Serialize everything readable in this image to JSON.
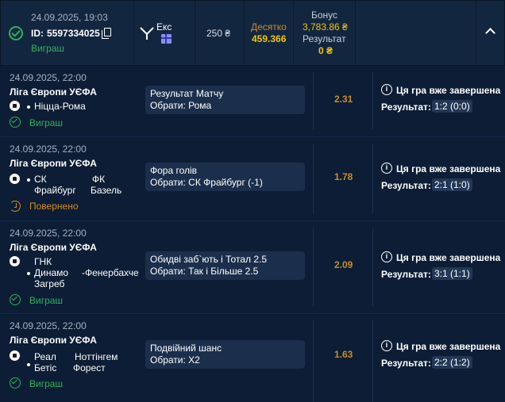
{
  "bet": {
    "date": "24.09.2025, 19:03",
    "id_label": "ID:",
    "id": "5597334025",
    "status": "Виграш",
    "type": "Екс",
    "stake": "250 ₴",
    "decimal_label": "Десятко",
    "decimal_value": "459.366",
    "bonus_label": "Бонус",
    "bonus_value": "3,783.86 ₴",
    "result_label": "Результат",
    "result_value": "0 ₴"
  },
  "events": [
    {
      "date": "24.09.2025, 22:00",
      "league": "Ліга Європи УЄФА",
      "team1": "Ніцца-Рома",
      "team2": "",
      "market": "Результат Матчу",
      "pick": "Обрати: Рома",
      "odds": "2.31",
      "status": "Виграш",
      "ended": "Ця гра вже завершена",
      "result_label": "Результат:",
      "result": "1:2 (0:0)"
    },
    {
      "date": "24.09.2025, 22:00",
      "league": "Ліга Європи УЄФА",
      "team1_l1": "СК",
      "team1_l2": "Фрайбург",
      "team2_l1": "ФК",
      "team2_l2": "Базель",
      "market": "Фора голів",
      "pick": "Обрати: СК Фрайбург (-1)",
      "odds": "1.78",
      "status": "Повернено",
      "ended": "Ця гра вже завершена",
      "result_label": "Результат:",
      "result": "2:1 (1:0)"
    },
    {
      "date": "24.09.2025, 22:00",
      "league": "Ліга Європи УЄФА",
      "team1_l1": "ГНК",
      "team1_l2": "Динамо",
      "team1_l3": "Загреб",
      "team2_l1": "-Фенербахче",
      "market": "Обидві заб`ють і Тотал 2.5",
      "pick": "Обрати: Так і Більше 2.5",
      "odds": "2.09",
      "status": "Виграш",
      "ended": "Ця гра вже завершена",
      "result_label": "Результат:",
      "result": "3:1 (1:1)"
    },
    {
      "date": "24.09.2025, 22:00",
      "league": "Ліга Європи УЄФА",
      "team1_l1": "Реал",
      "team1_l2": "Бетіс",
      "team2_l1": "Ноттінгем",
      "team2_l2": "Форест",
      "market": "Подвійний шанс",
      "pick": "Обрати: Х2",
      "odds": "1.63",
      "status": "Виграш",
      "ended": "Ця гра вже завершена",
      "result_label": "Результат:",
      "result": "2:2 (1:2)"
    }
  ],
  "colors": {
    "background": "#0c1d35",
    "header": "#132640",
    "win": "#2ab35a",
    "returned": "#d98a1a",
    "odds": "#c98e22",
    "decimal": "#f2c500"
  }
}
